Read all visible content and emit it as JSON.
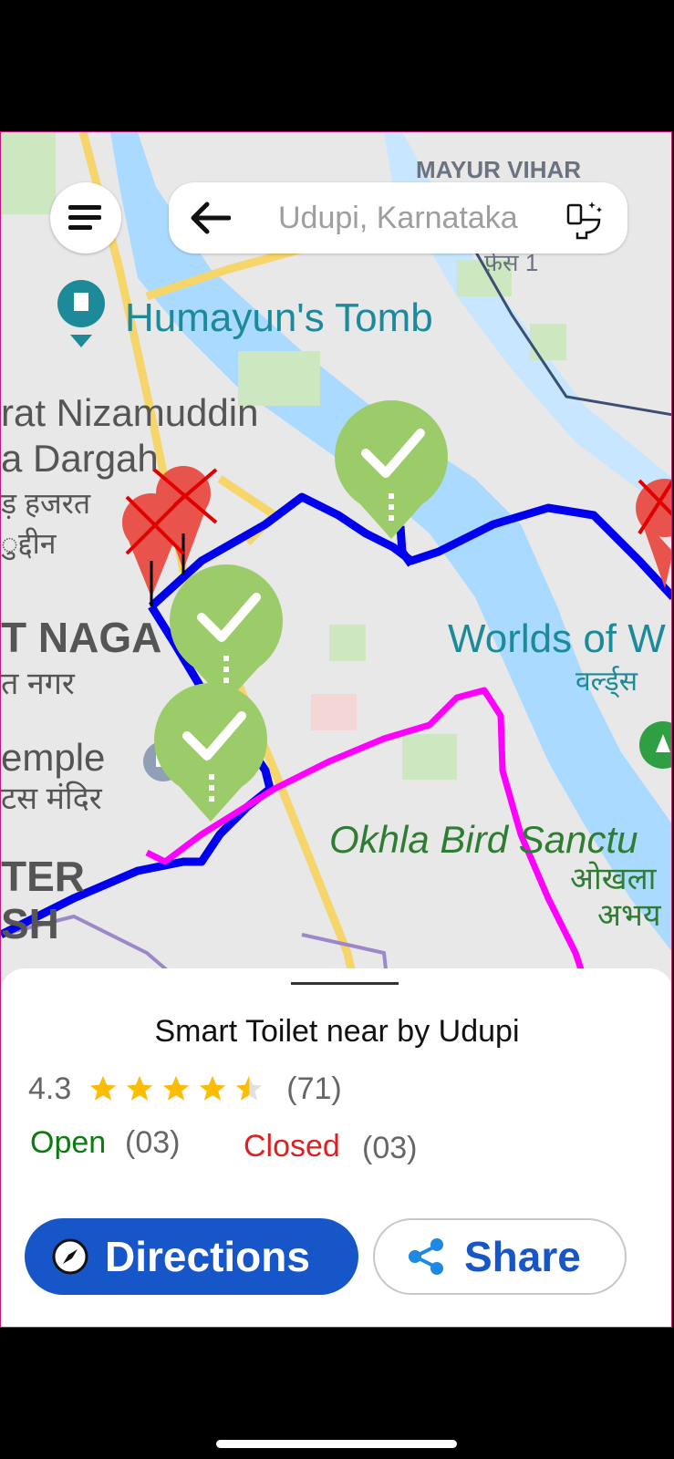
{
  "search": {
    "placeholder": "Udupi, Karnataka"
  },
  "map": {
    "labels": {
      "mayur_vihar": "MAYUR VIHAR",
      "phase1": "फ़ेस 1",
      "humayun": "Humayun's Tomb",
      "nizamuddin_1": "rat Nizamuddin",
      "nizamuddin_2": "a Dargah",
      "nizamuddin_hi_1": "ड़ हजरत",
      "nizamuddin_hi_2": "ुद्दीन",
      "nagar": "T NAGA",
      "nagar_hi": "त नगर",
      "worlds": "Worlds of W",
      "worlds_hi": "वर्ल्ड्स",
      "temple": "emple",
      "temple_hi": "टस मंदिर",
      "okhla": "Okhla Bird Sanctu",
      "okhla_hi_1": "ओखला",
      "okhla_hi_2": "अभय",
      "ter": "TER",
      "sh": "SH"
    },
    "route_colors": {
      "primary": "#0000ee",
      "secondary": "#ff00ff"
    },
    "marker_colors": {
      "open": "#9ccc6a",
      "closed": "#e8534b"
    }
  },
  "place": {
    "title": "Smart Toilet near by Udupi",
    "rating": "4.3",
    "rating_value": 4.3,
    "rating_max": 5,
    "review_count": "(71)",
    "open_label": "Open",
    "open_count": "(03)",
    "closed_label": "Closed",
    "closed_count": "(03)"
  },
  "actions": {
    "directions_label": "Directions",
    "share_label": "Share"
  },
  "colors": {
    "accent": "#1756c8",
    "star": "#fbbc04",
    "open": "#0b7a12",
    "closed": "#e02020"
  }
}
